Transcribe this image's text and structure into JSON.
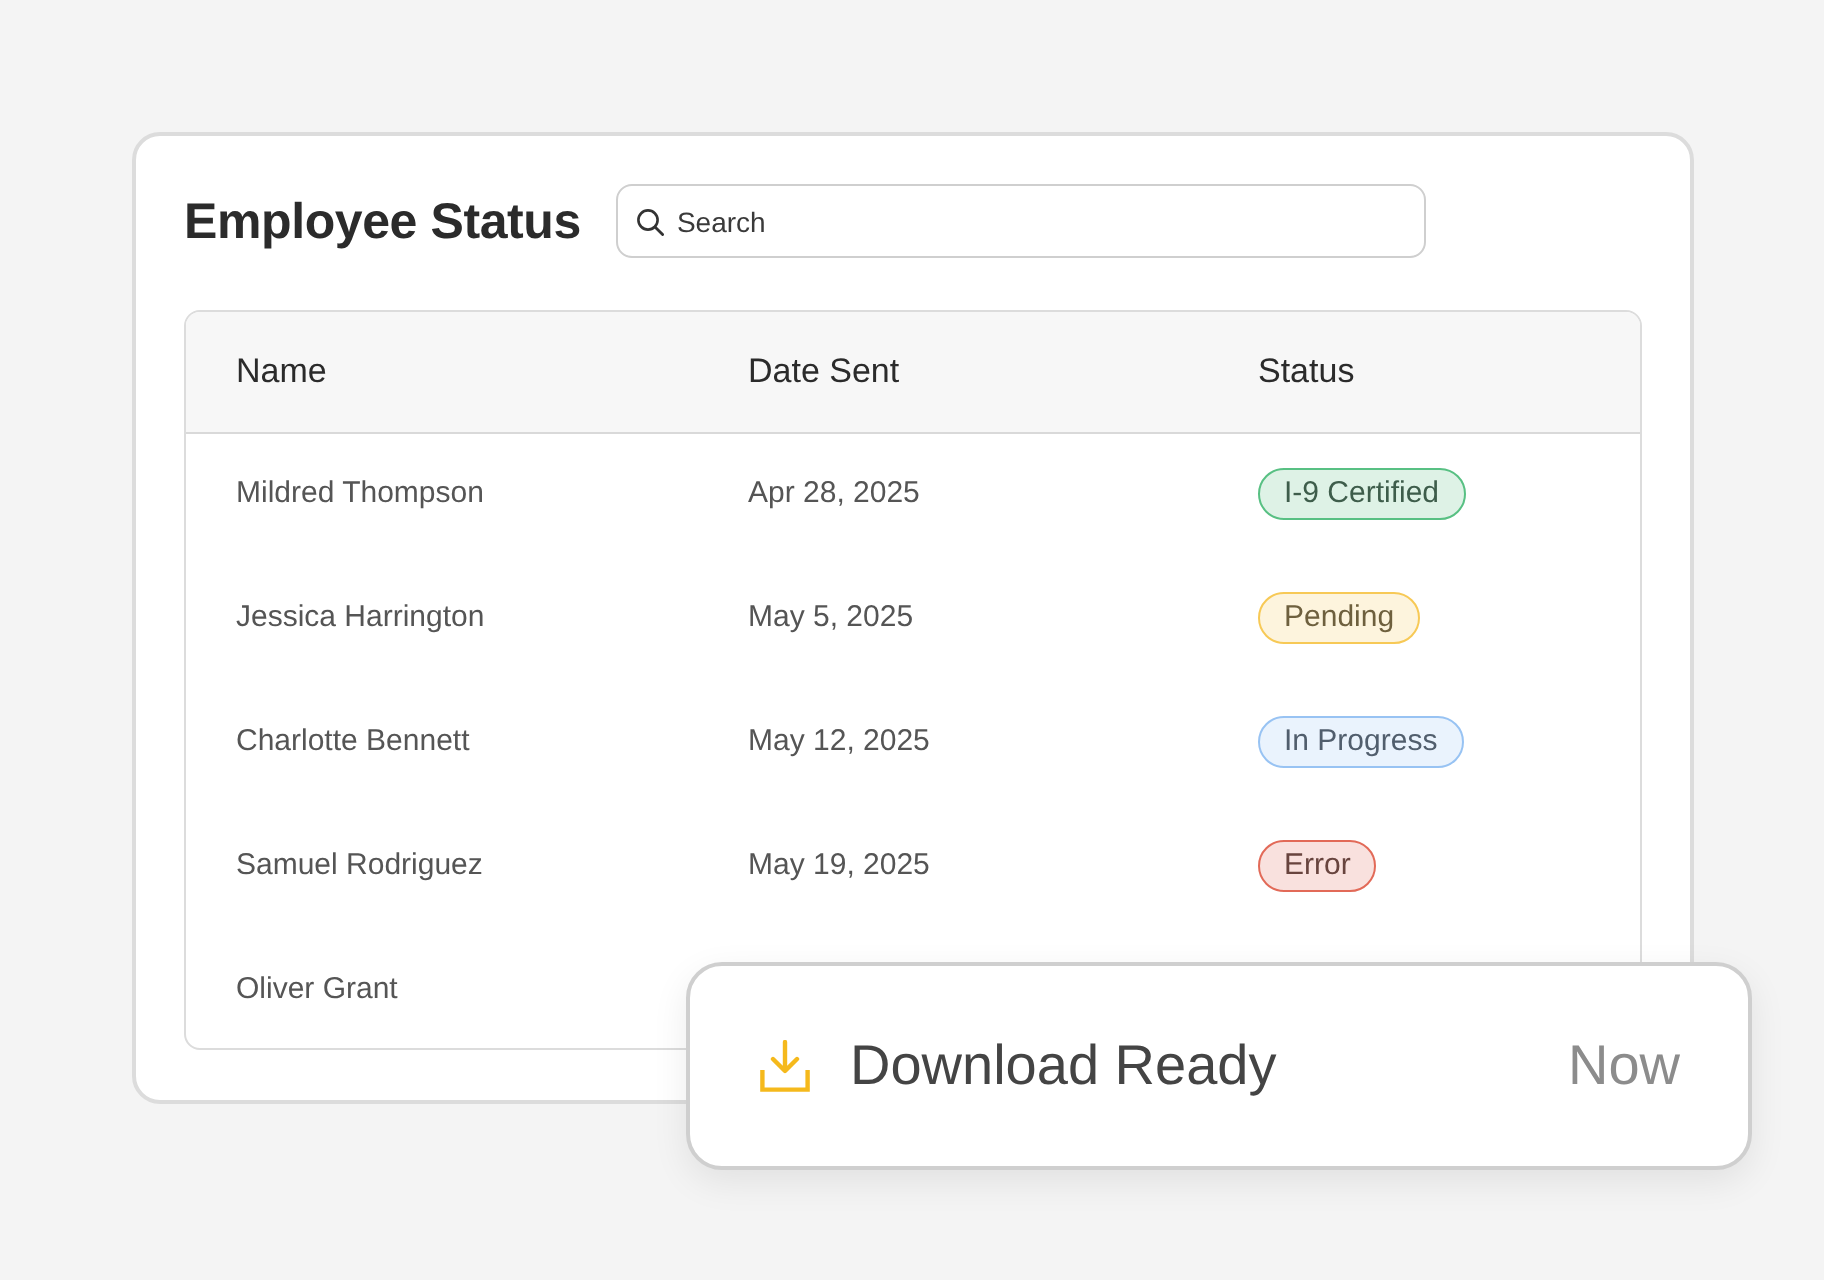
{
  "card": {
    "title": "Employee Status",
    "search": {
      "placeholder": "Search"
    }
  },
  "table": {
    "columns": [
      "Name",
      "Date Sent",
      "Status"
    ],
    "rows": [
      {
        "name": "Mildred Thompson",
        "date_sent": "Apr 28, 2025",
        "status": {
          "label": "I-9 Certified",
          "color": "#58c083"
        }
      },
      {
        "name": "Jessica Harrington",
        "date_sent": "May 5, 2025",
        "status": {
          "label": "Pending",
          "color": "#f7c956"
        }
      },
      {
        "name": "Charlotte Bennett",
        "date_sent": "May 12, 2025",
        "status": {
          "label": "In Progress",
          "color": "#98c3f3"
        }
      },
      {
        "name": "Samuel Rodriguez",
        "date_sent": "May 19, 2025",
        "status": {
          "label": "Error",
          "color": "#e26a58"
        }
      },
      {
        "name": "Oliver Grant"
      }
    ]
  },
  "toast": {
    "title": "Download Ready",
    "time": "Now"
  }
}
